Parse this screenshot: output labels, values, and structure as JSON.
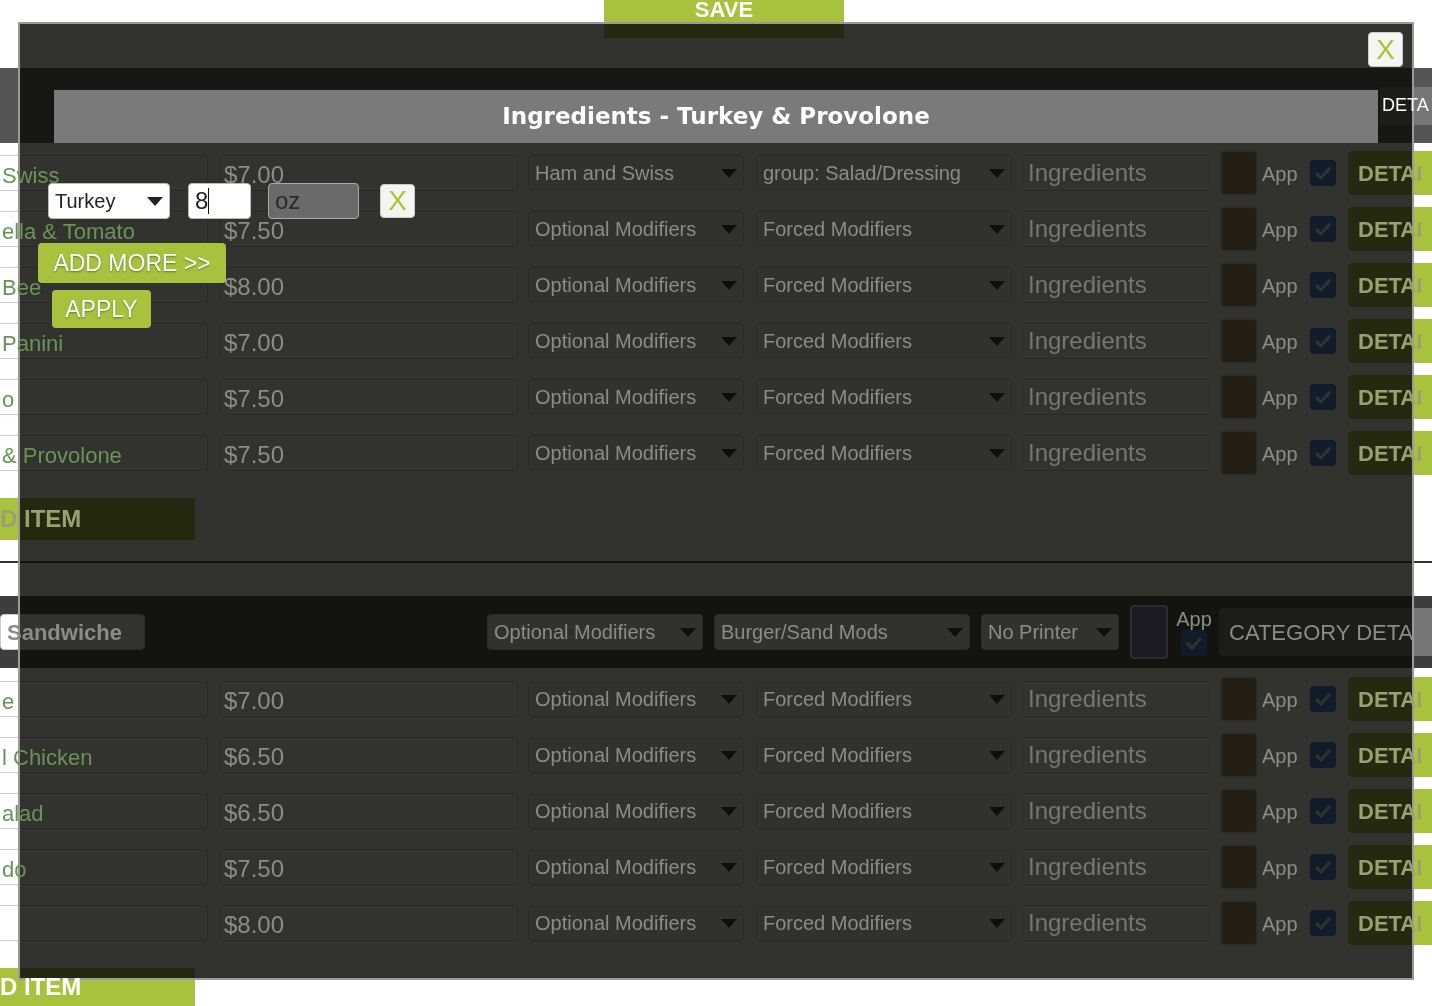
{
  "save_button": "SAVE",
  "categories": [
    {
      "details_button": "DETA",
      "add_button": "D ITEM",
      "items": [
        {
          "name": "Swiss",
          "price": "$7.00",
          "optional": "Ham and Swiss",
          "forced": "group: Salad/Dressing",
          "ingredients_placeholder": "Ingredients",
          "app_label": "App",
          "app_checked": true,
          "details_button": "DETAI"
        },
        {
          "name": "ella & Tomato",
          "price": "$7.50",
          "optional": "Optional Modifiers",
          "forced": "Forced Modifiers",
          "ingredients_placeholder": "Ingredients",
          "app_label": "App",
          "app_checked": true,
          "details_button": "DETAI"
        },
        {
          "name": "Bee",
          "price": "$8.00",
          "optional": "Optional Modifiers",
          "forced": "Forced Modifiers",
          "ingredients_placeholder": "Ingredients",
          "app_label": "App",
          "app_checked": true,
          "details_button": "DETAI"
        },
        {
          "name": "Panini",
          "price": "$7.00",
          "optional": "Optional Modifiers",
          "forced": "Forced Modifiers",
          "ingredients_placeholder": "Ingredients",
          "app_label": "App",
          "app_checked": true,
          "details_button": "DETAI"
        },
        {
          "name": "o",
          "price": "$7.50",
          "optional": "Optional Modifiers",
          "forced": "Forced Modifiers",
          "ingredients_placeholder": "Ingredients",
          "app_label": "App",
          "app_checked": true,
          "details_button": "DETAI"
        },
        {
          "name": "& Provolone",
          "price": "$7.50",
          "optional": "Optional Modifiers",
          "forced": "Forced Modifiers",
          "ingredients_placeholder": "Ingredients",
          "app_label": "App",
          "app_checked": true,
          "details_button": "DETAI"
        }
      ]
    },
    {
      "name": "Sandwiche",
      "optional": "Optional Modifiers",
      "forced": "Burger/Sand Mods",
      "printer": "No Printer",
      "app_label": "App",
      "app_checked": true,
      "details_button": "CATEGORY DETA",
      "add_button": "D ITEM",
      "items": [
        {
          "name": "e",
          "price": "$7.00",
          "optional": "Optional Modifiers",
          "forced": "Forced Modifiers",
          "ingredients_placeholder": "Ingredients",
          "app_label": "App",
          "app_checked": true,
          "details_button": "DETAI"
        },
        {
          "name": "l Chicken",
          "price": "$6.50",
          "optional": "Optional Modifiers",
          "forced": "Forced Modifiers",
          "ingredients_placeholder": "Ingredients",
          "app_label": "App",
          "app_checked": true,
          "details_button": "DETAI"
        },
        {
          "name": "alad",
          "price": "$6.50",
          "optional": "Optional Modifiers",
          "forced": "Forced Modifiers",
          "ingredients_placeholder": "Ingredients",
          "app_label": "App",
          "app_checked": true,
          "details_button": "DETAI"
        },
        {
          "name": "do",
          "price": "$7.50",
          "optional": "Optional Modifiers",
          "forced": "Forced Modifiers",
          "ingredients_placeholder": "Ingredients",
          "app_label": "App",
          "app_checked": true,
          "details_button": "DETAI"
        },
        {
          "price": "$8.00",
          "optional": "Optional Modifiers",
          "forced": "Forced Modifiers",
          "ingredients_placeholder": "Ingredients",
          "app_label": "App",
          "app_checked": true,
          "details_button": "DETAI"
        }
      ]
    }
  ],
  "modal": {
    "title": "Ingredients - Turkey & Provolone",
    "close": "X",
    "ingredients": [
      {
        "ingredient": "Turkey",
        "amount": "8",
        "unit": {
          "value": "oz",
          "disabled": true
        },
        "remove": "X"
      }
    ],
    "add_more": "ADD MORE >>",
    "apply": "APPLY"
  }
}
